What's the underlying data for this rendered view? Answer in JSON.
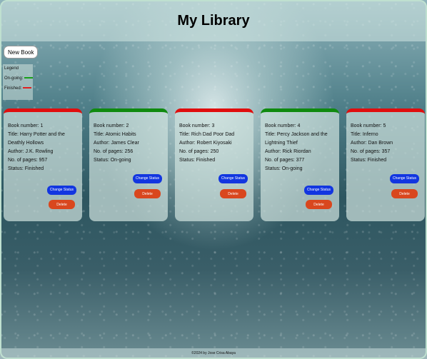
{
  "header": {
    "title": "My Library"
  },
  "toolbar": {
    "new_book_label": "New Book"
  },
  "legend": {
    "title": "Legend",
    "ongoing_label": "On-going:",
    "finished_label": "Finished:",
    "ongoing_color": "#18a018",
    "finished_color": "#e02020"
  },
  "books": [
    {
      "number": "Book number: 1",
      "title": "Title: Harry Potter and the Deathly Hollows",
      "author": "Author: J.K. Rowling",
      "pages": "No. of pages: 957",
      "status": "Status: Finished",
      "state": "finished"
    },
    {
      "number": "Book number: 2",
      "title": "Title: Atomic Habits",
      "author": "Author: James Clear",
      "pages": "No. of pages: 256",
      "status": "Status: On-going",
      "state": "ongoing"
    },
    {
      "number": "Book number: 3",
      "title": "Title: Rich Dad Poor Dad",
      "author": "Author: Robert Kiyosaki",
      "pages": "No. of pages: 250",
      "status": "Status: Finished",
      "state": "finished"
    },
    {
      "number": "Book number: 4",
      "title": "Title: Percy Jackson and the Lightning Thief",
      "author": "Author: Rick Riordan",
      "pages": "No. of pages: 377",
      "status": "Status: On-going",
      "state": "ongoing"
    },
    {
      "number": "Book number: 5",
      "title": "Title: Inferno",
      "author": "Author: Dan Brown",
      "pages": "No. of pages: 357",
      "status": "Status: Finished",
      "state": "finished"
    }
  ],
  "card_buttons": {
    "change_status": "Change Status",
    "delete": "Delete"
  },
  "footer": {
    "text": "©2024 by Jose Crisa Abaya"
  }
}
